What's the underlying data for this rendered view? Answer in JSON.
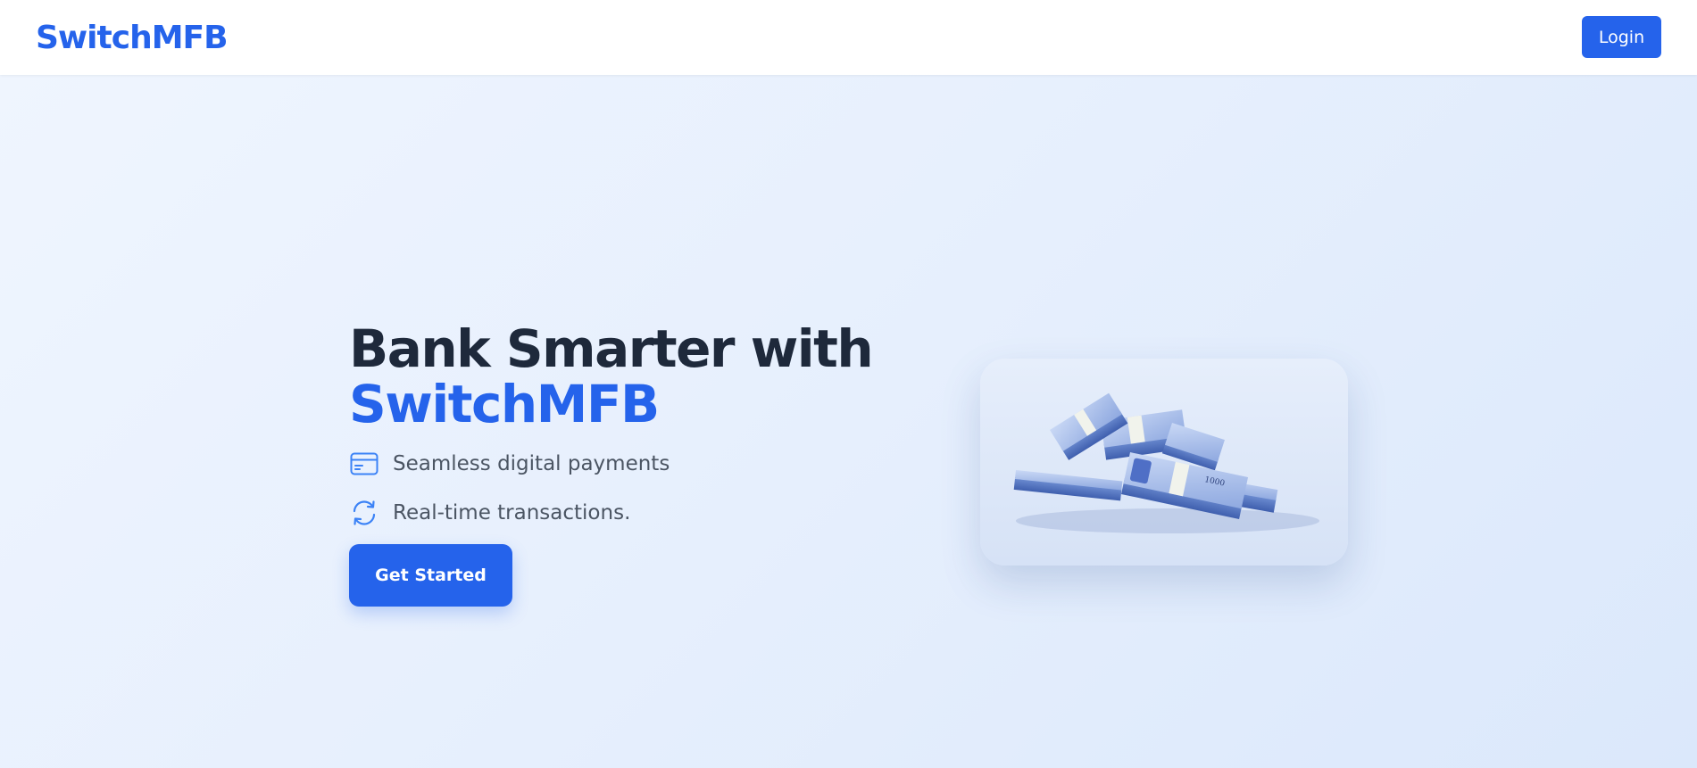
{
  "header": {
    "brand": "SwitchMFB",
    "login_label": "Login"
  },
  "hero": {
    "headline_line1": "Bank Smarter with",
    "headline_accent": "SwitchMFB",
    "features": [
      {
        "icon": "credit-card-icon",
        "label": "Seamless digital payments"
      },
      {
        "icon": "refresh-icon",
        "label": "Real-time transactions."
      }
    ],
    "cta_label": "Get Started",
    "image": {
      "subject": "money-stack-image",
      "note_value": "1000"
    }
  },
  "colors": {
    "brand": "#2563eb",
    "heading": "#1e293b",
    "body_text": "#4b5563",
    "hero_bg": "#e6effd"
  }
}
